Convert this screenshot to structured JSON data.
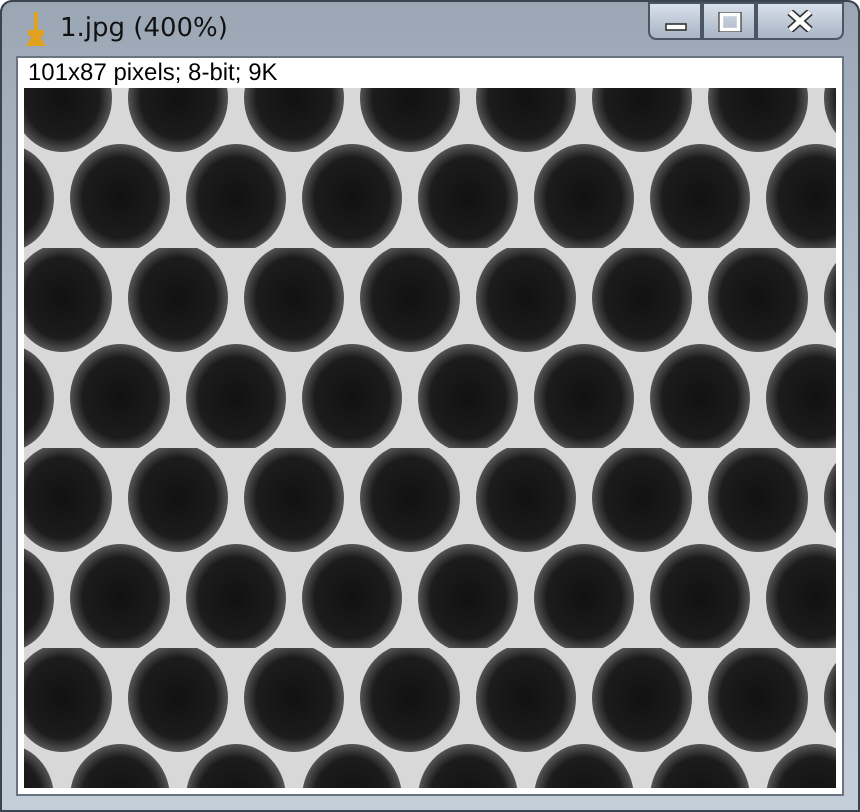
{
  "window": {
    "title": "1.jpg (400%)"
  },
  "image_info": "101x87 pixels; 8-bit; 9K"
}
